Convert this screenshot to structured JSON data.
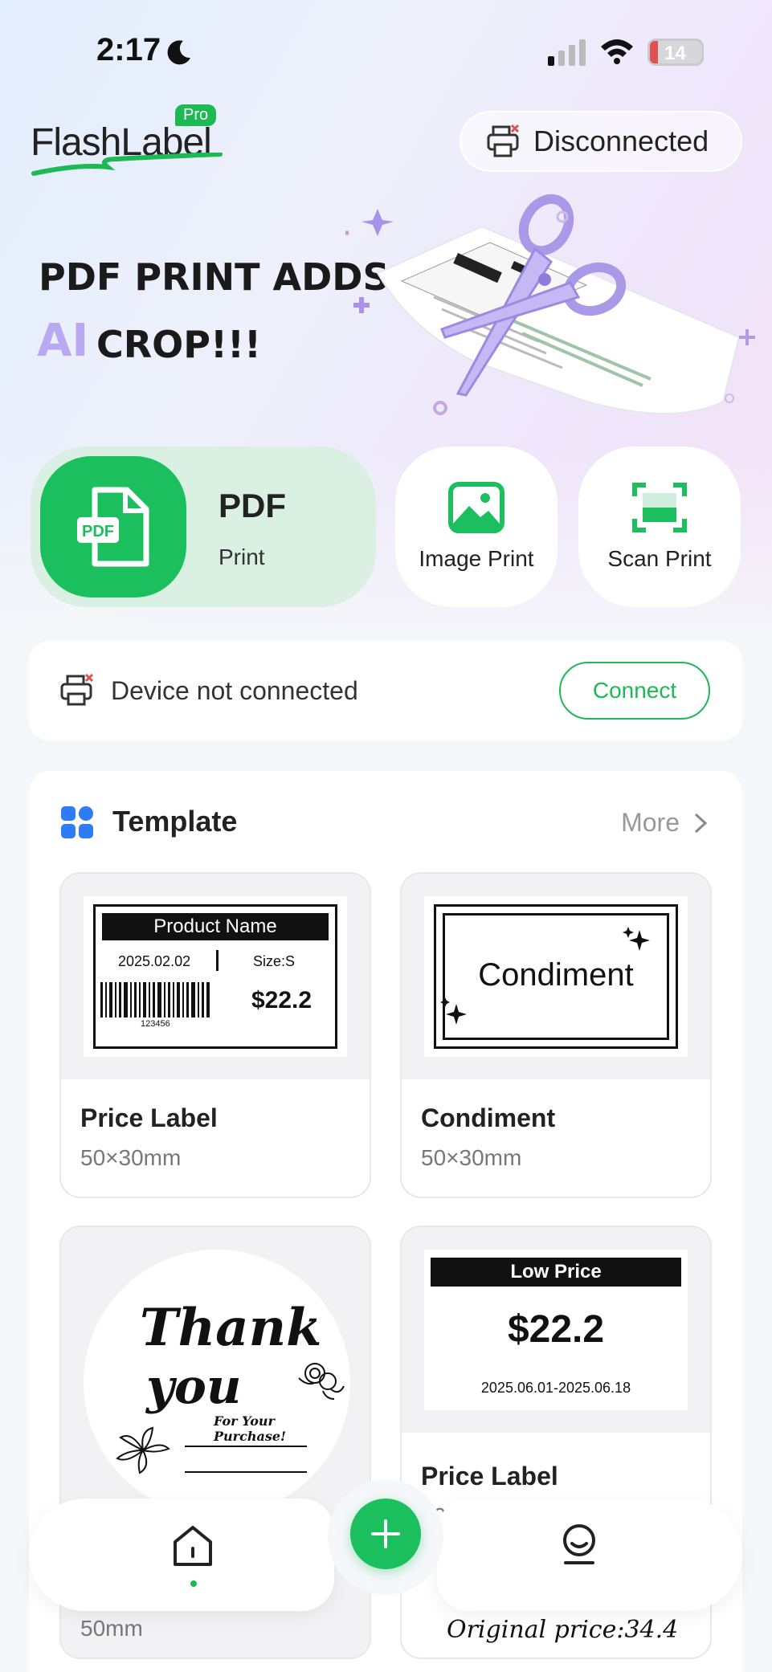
{
  "status_bar": {
    "time": "2:17",
    "battery": "14"
  },
  "header": {
    "logo_text": "FlashLabel",
    "logo_badge": "Pro",
    "connection_status": "Disconnected"
  },
  "banner": {
    "line1": "PDF PRINT ADDS",
    "ai": "AI",
    "line2": "CROP!!!"
  },
  "quick_actions": {
    "pdf_title": "PDF",
    "pdf_subtitle": "Print",
    "image_print": "Image Print",
    "scan_print": "Scan Print"
  },
  "device": {
    "status_text": "Device not connected",
    "connect_label": "Connect"
  },
  "templates": {
    "title": "Template",
    "more": "More",
    "items": [
      {
        "name": "Price Label",
        "size": "50×30mm"
      },
      {
        "name": "Condiment",
        "size": "50×30mm"
      },
      {
        "name": "",
        "size": "50mm"
      },
      {
        "name": "Price Label",
        "size": "50"
      }
    ],
    "price_label_thumb": {
      "header": "Product Name",
      "date": "2025.02.02",
      "size": "Size:S",
      "price": "$22.2",
      "code": "123456"
    },
    "condiment_thumb": {
      "text": "Condiment"
    },
    "thank_you_thumb": {
      "line1": "Thank",
      "line2": "you",
      "sub": "For Your Purchase!"
    },
    "low_price_thumb": {
      "header": "Low Price",
      "price": "$22.2",
      "dates": "2025.06.01-2025.06.18"
    },
    "original_price_thumb": {
      "text": "Original price:34.4"
    }
  },
  "colors": {
    "accent": "#1bbf5d",
    "ai_text": "#b9a8f2",
    "disconnect_mark": "#e05252"
  }
}
